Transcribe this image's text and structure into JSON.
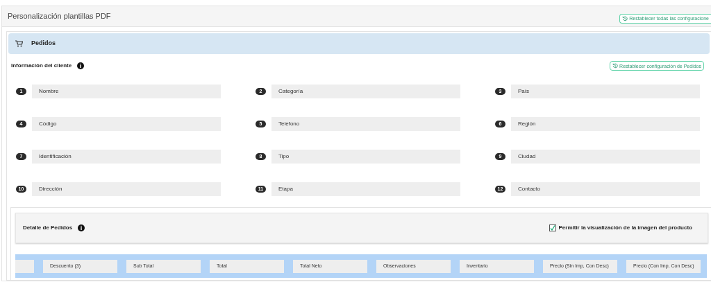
{
  "page": {
    "title": "Personalización plantillas PDF",
    "reset_all_button": "Restablecer todas las configuracione"
  },
  "section": {
    "title": "Pedidos"
  },
  "client_info": {
    "title": "Información del cliente",
    "reset_button": "Restablecer configuración de Pedidos",
    "fields": [
      {
        "number": "1",
        "label": "Nombre"
      },
      {
        "number": "2",
        "label": "Categoría"
      },
      {
        "number": "3",
        "label": "País"
      },
      {
        "number": "4",
        "label": "Código"
      },
      {
        "number": "5",
        "label": "Telefono"
      },
      {
        "number": "6",
        "label": "Región"
      },
      {
        "number": "7",
        "label": "Identificación"
      },
      {
        "number": "8",
        "label": "Tipo"
      },
      {
        "number": "9",
        "label": "Ciudad"
      },
      {
        "number": "10",
        "label": "Dirección"
      },
      {
        "number": "11",
        "label": "Etapa"
      },
      {
        "number": "12",
        "label": "Contacto"
      }
    ]
  },
  "order_detail": {
    "title": "Detalle de Pedidos",
    "show_image": {
      "label": "Permitir la visualización de la imagen del producto",
      "checked": true
    },
    "columns": [
      "Descuento (3)",
      "Sub Total",
      "Total",
      "Total Neto",
      "Observaciones",
      "Inventario",
      "Precio (Sin Imp, Con Desc)",
      "Precio (Con Imp, Con Desc)"
    ]
  }
}
